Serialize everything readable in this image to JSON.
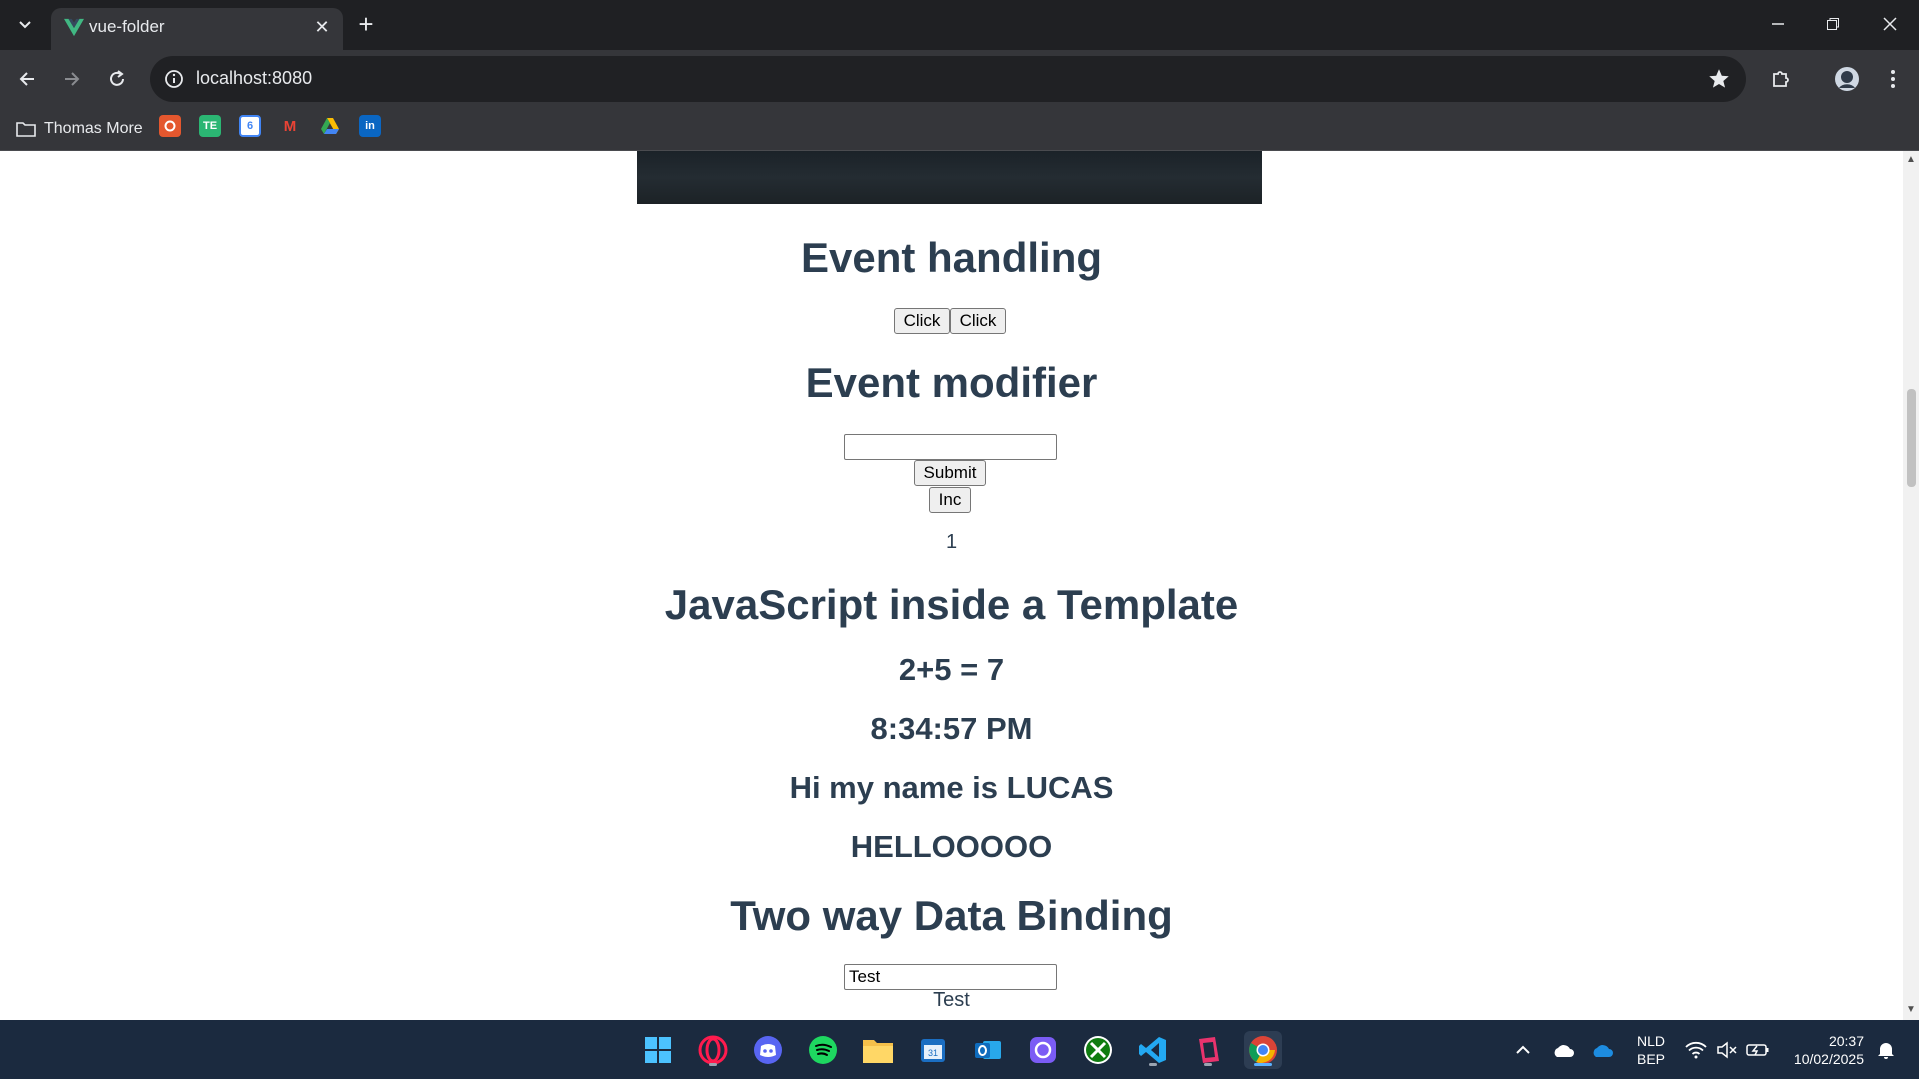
{
  "browser": {
    "tab_title": "vue-folder",
    "url": "localhost:8080",
    "bookmark_folder": "Thomas More",
    "bookmarks": [
      {
        "name": "git-icon",
        "label": "",
        "color": "#e4572e"
      },
      {
        "name": "te-icon",
        "label": "TE",
        "color": "#2bb673"
      },
      {
        "name": "calendar-icon",
        "label": "6",
        "color": "#4285f4"
      },
      {
        "name": "gmail-icon",
        "label": "M",
        "color": "#ea4335"
      },
      {
        "name": "drive-icon",
        "label": "",
        "color": "#fbbc04"
      },
      {
        "name": "linkedin-icon",
        "label": "in",
        "color": "#0a66c2"
      }
    ]
  },
  "page": {
    "event_handling": {
      "heading": "Event handling",
      "button1": "Click",
      "button2": "Click"
    },
    "event_modifier": {
      "heading": "Event modifier",
      "input_value": "",
      "submit_label": "Submit",
      "inc_label": "Inc",
      "counter": "1"
    },
    "js_template": {
      "heading": "JavaScript inside a Template",
      "sum": "2+5 = 7",
      "time": "8:34:57 PM",
      "greeting": "Hi my name is LUCAS",
      "hello": "HELLOOOOO"
    },
    "two_way": {
      "heading": "Two way Data Binding",
      "input_value": "Test",
      "mirror": "Test"
    }
  },
  "taskbar": {
    "language_top": "NLD",
    "language_bottom": "BEP",
    "time": "20:37",
    "date": "10/02/2025"
  },
  "colors": {
    "heading": "#2c3e50",
    "chrome_dark": "#1f2023",
    "chrome_toolbar": "#35363a",
    "taskbar": "#1b2a3f"
  }
}
